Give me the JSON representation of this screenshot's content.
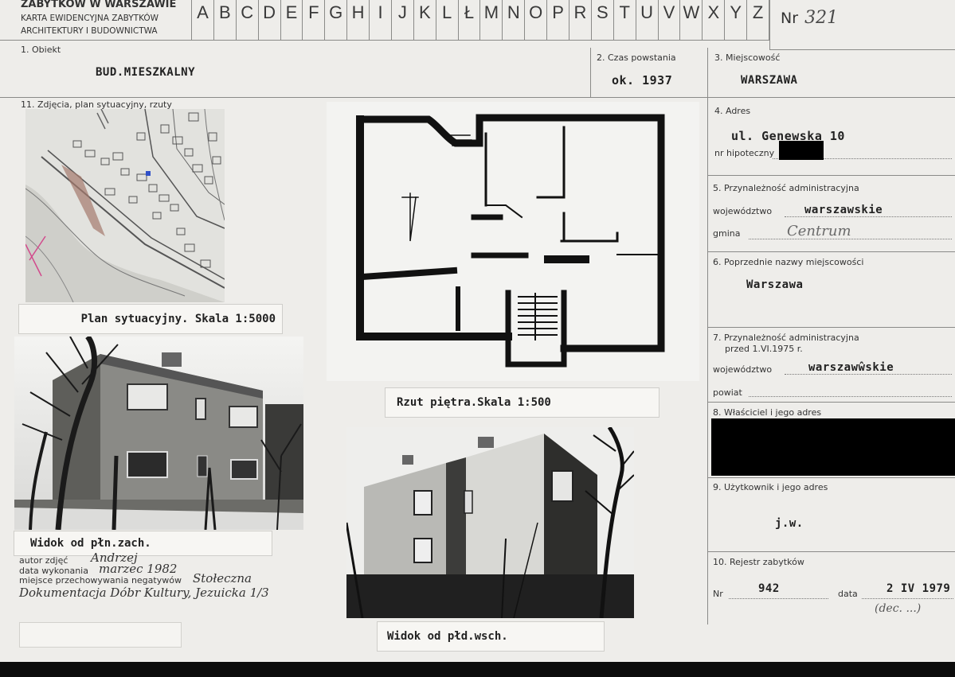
{
  "header": {
    "org_line1": "ZABYTKÓW W WARSZAWIE",
    "org_line2": "KARTA EWIDENCYJNA ZABYTKÓW",
    "org_line3": "ARCHITEKTURY I BUDOWNICTWA",
    "alphabet": [
      "A",
      "B",
      "C",
      "D",
      "E",
      "F",
      "G",
      "H",
      "I",
      "J",
      "K",
      "L",
      "Ł",
      "M",
      "N",
      "O",
      "P",
      "R",
      "S",
      "T",
      "U",
      "V",
      "W",
      "X",
      "Y",
      "Z"
    ],
    "number_label": "Nr",
    "number_value": "321"
  },
  "fields": {
    "obiekt_label": "1. Obiekt",
    "obiekt_value": "BUD.MIESZKALNY",
    "czas_label": "2. Czas powstania",
    "czas_value": "ok. 1937",
    "miejscowosc_label": "3. Miejscowość",
    "miejscowosc_value": "WARSZAWA",
    "zdjecia_label": "11. Zdjęcia, plan sytuacyjny, rzuty",
    "adres_label": "4. Adres",
    "adres_value": "ul. Genewska 10",
    "hipoteczny_label": "nr hipoteczny",
    "przynaleznosc_label": "5. Przynależność administracyjna",
    "wojewodztwo_label": "województwo",
    "wojewodztwo_value": "warszawskie",
    "gmina_label": "gmina",
    "gmina_value": "Centrum",
    "poprzednie_label": "6. Poprzednie nazwy miejscowości",
    "poprzednie_value": "Warszawa",
    "przynaleznosc2_label": "7. Przynależność administracyjna",
    "przynaleznosc2_sub": "przed 1.VI.1975 r.",
    "wojewodztwo2_label": "województwo",
    "wojewodztwo2_value": "warszawŵskie",
    "powiat_label": "powiat",
    "wlasciciel_label": "8. Właściciel i jego adres",
    "uzytkownik_label": "9. Użytkownik i jego adres",
    "uzytkownik_value": "j.w.",
    "rejestr_label": "10. Rejestr zabytków",
    "nr_label": "Nr",
    "nr_value": "942",
    "data_label": "data",
    "data_value": "2 IV 1979",
    "signature": "(dec. ...)"
  },
  "captions": {
    "plan": "Plan sytuacyjny. Skala 1:5000",
    "rzut": "Rzut piętra.Skala 1:500",
    "widok1": "Widok od płn.zach.",
    "widok2": "Widok od płd.wsch."
  },
  "credits": {
    "autor_label": "autor zdjęć",
    "autor_value": "Andrzej",
    "data_label": "data wykonania",
    "data_value": "marzec 1982",
    "miejsce_label": "miejsce przechowywania negatywów",
    "miejsce_value": "Stołeczna",
    "dokumentacja": "Dokumentacja Dóbr Kultury, Jezuicka 1/3"
  }
}
